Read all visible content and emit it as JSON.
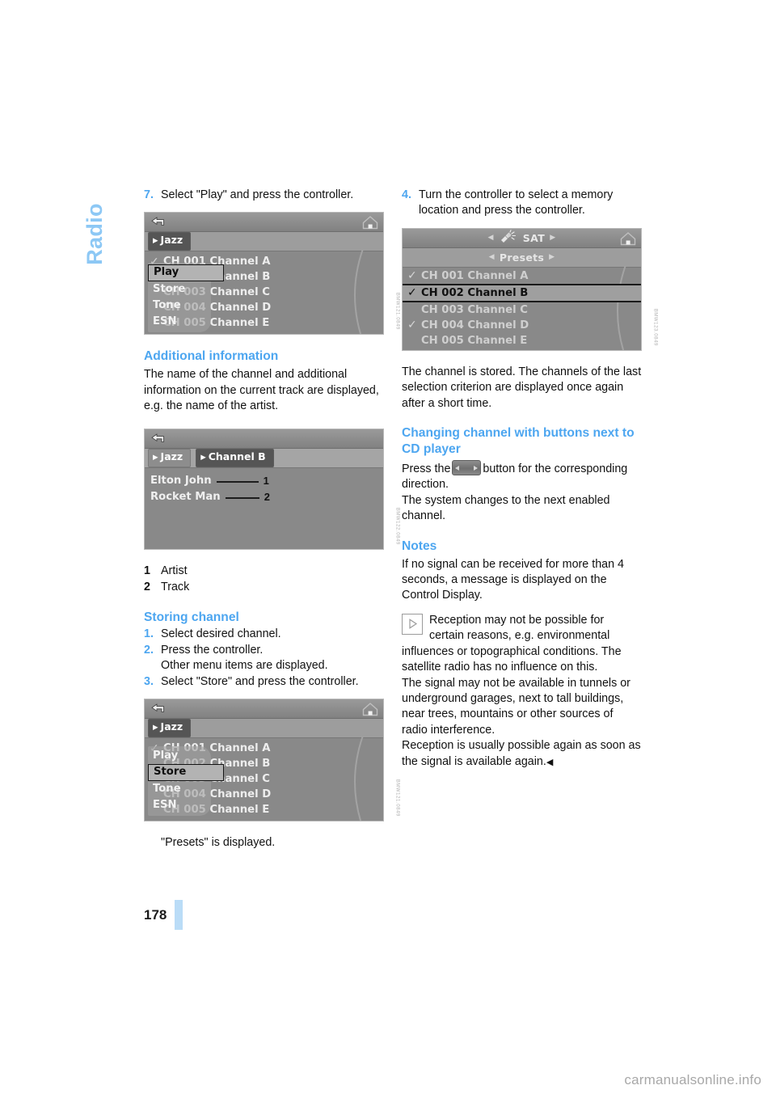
{
  "page": {
    "chapter": "Radio",
    "number": "178",
    "watermark": "carmanualsonline.info",
    "accent_blue": "#4da6f0",
    "tab_blue": "#8dc8f5",
    "footer_bar_color": "#badcf7"
  },
  "left_column": {
    "step7": {
      "num": "7.",
      "text": "Select \"Play\" and press the controller."
    },
    "figure_play": {
      "code": "BMW121.0849",
      "statusbar": {
        "back": "back-icon",
        "home": "home-icon"
      },
      "tab": "Jazz",
      "rows": [
        {
          "tick": "✓",
          "label": "CH 001 Channel A"
        },
        {
          "tick": "",
          "label": "CH 002 Channel B"
        },
        {
          "tick": "",
          "label": "CH 003 Channel C"
        },
        {
          "tick": "",
          "label": "CH 004 Channel D"
        },
        {
          "tick": "",
          "label": "CH 005 Channel E"
        }
      ],
      "popup": {
        "items": [
          "Play",
          "Store",
          "Tone",
          "ESN"
        ],
        "active": "Play"
      }
    },
    "additional_information": {
      "heading": "Additional information",
      "body": "The name of the channel and additional information on the current track are displayed, e.g. the name of the artist."
    },
    "figure_info": {
      "code": "BMW122.0849",
      "tab1": "Jazz",
      "tab2": "Channel B",
      "artist": "Elton John",
      "track": "Rocket Man",
      "callout1": "1",
      "callout2": "2"
    },
    "legend": [
      {
        "num": "1",
        "label": "Artist"
      },
      {
        "num": "2",
        "label": "Track"
      }
    ],
    "storing_channel": {
      "heading": "Storing channel",
      "steps": [
        {
          "num": "1.",
          "text": "Select desired channel."
        },
        {
          "num": "2.",
          "text": "Press the controller.",
          "sub": "Other menu items are displayed."
        },
        {
          "num": "3.",
          "text": "Select \"Store\" and press the controller."
        }
      ]
    },
    "figure_store": {
      "code": "BMW121.0849",
      "tab": "Jazz",
      "rows": [
        {
          "tick": "✓",
          "label": "CH 001 Channel A"
        },
        {
          "tick": "",
          "label": "CH 002 Channel B"
        },
        {
          "tick": "",
          "label": "CH 003 Channel C"
        },
        {
          "tick": "",
          "label": "CH 004 Channel D"
        },
        {
          "tick": "",
          "label": "CH 005 Channel E"
        }
      ],
      "popup": {
        "items": [
          "Play",
          "Store",
          "Tone",
          "ESN"
        ],
        "active": "Store"
      }
    },
    "presets_caption": "\"Presets\" is displayed."
  },
  "right_column": {
    "step4": {
      "num": "4.",
      "text": "Turn the controller to select a memory location and press the controller."
    },
    "figure_presets": {
      "code": "BMW123.0849",
      "title": "SAT",
      "tab": "Presets",
      "rows": [
        {
          "tick": "✓",
          "label": "CH 001 Channel A",
          "selected": false,
          "dim": true
        },
        {
          "tick": "✓",
          "label": "CH 002 Channel B",
          "selected": true,
          "dim": false
        },
        {
          "tick": "",
          "label": "CH 003 Channel C",
          "selected": false,
          "dim": true
        },
        {
          "tick": "✓",
          "label": "CH 004 Channel D",
          "selected": false,
          "dim": true
        },
        {
          "tick": "",
          "label": "CH 005 Channel E",
          "selected": false,
          "dim": true
        }
      ]
    },
    "stored_body": "The channel is stored. The channels of the last selection criterion are displayed once again after a short time.",
    "changing_channel": {
      "heading": "Changing channel with buttons next to CD player",
      "text_before": "Press the",
      "text_after": "button for the corresponding direction.",
      "line2": "The system changes to the next enabled channel."
    },
    "notes": {
      "heading": "Notes",
      "body1": "If no signal can be received for more than 4 seconds, a message is displayed on the Control Display.",
      "note_icon": "triangle-note-icon",
      "body2": "Reception may not be possible for certain reasons, e.g. environmental influences or topographical conditions. The satellite radio has no influence on this.",
      "body3": "The signal may not be available in tunnels or underground garages, next to tall buildings, near trees, mountains or other sources of radio interference.",
      "body4": "Reception is usually possible again as soon as the signal is available again.",
      "end_marker": "◀"
    }
  }
}
